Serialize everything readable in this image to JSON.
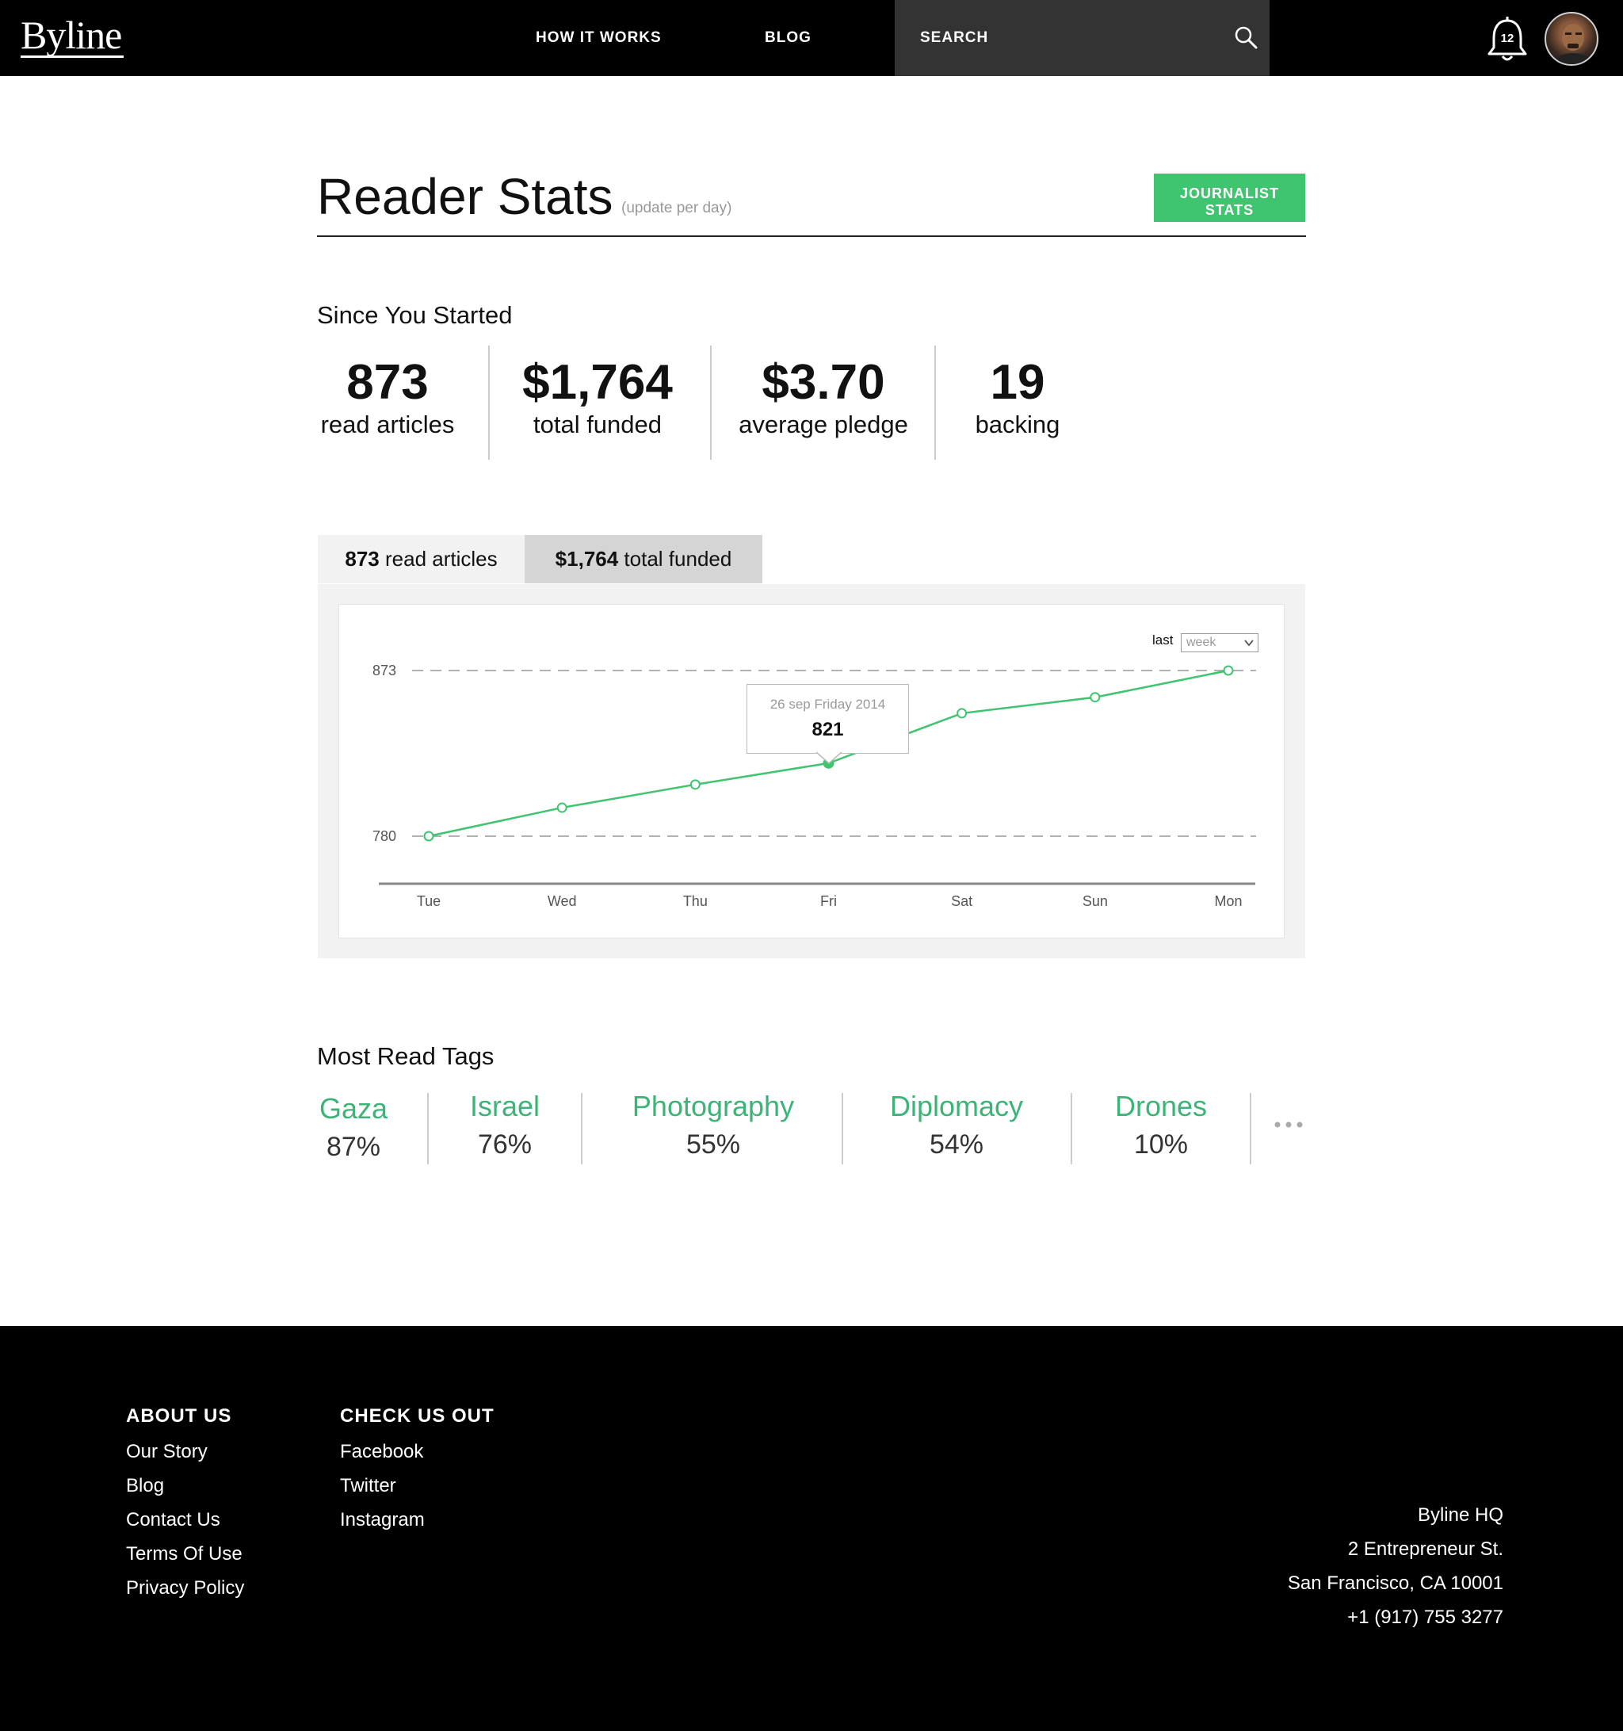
{
  "nav": {
    "logo": "Byline",
    "how_it_works": "HOW IT WORKS",
    "blog": "BLOG",
    "search_placeholder": "SEARCH",
    "notification_count": "12"
  },
  "header": {
    "title": "Reader Stats",
    "subtitle": "(update per day)",
    "journalist_button_line1": "JOURNALIST",
    "journalist_button_line2": "STATS"
  },
  "since": {
    "title": "Since You Started",
    "stats": [
      {
        "value": "873",
        "label": "read articles"
      },
      {
        "value": "$1,764",
        "label": "total funded"
      },
      {
        "value": "$3.70",
        "label": "average pledge"
      },
      {
        "value": "19",
        "label": "backing"
      }
    ]
  },
  "tabs": [
    {
      "value": "873",
      "label": " read articles"
    },
    {
      "value": "$1,764",
      "label": " total funded"
    }
  ],
  "period": {
    "label": "last",
    "selected": "week"
  },
  "tooltip": {
    "date": "26 sep Friday 2014",
    "value": "821"
  },
  "chart_data": {
    "type": "line",
    "categories": [
      "Tue",
      "Wed",
      "Thu",
      "Fri",
      "Sat",
      "Sun",
      "Mon"
    ],
    "series": [
      {
        "values": [
          780,
          796,
          809,
          821,
          849,
          858,
          873
        ]
      }
    ],
    "ylim": [
      780,
      873
    ],
    "y_ticks": [
      780,
      873
    ],
    "highlight_index": 3,
    "grid": "dashed",
    "colors": {
      "line": "#3fc46f",
      "grid": "#999999",
      "axis": "#888888"
    }
  },
  "tags": {
    "title": "Most Read Tags",
    "items": [
      {
        "name": "Gaza",
        "pct": "87%"
      },
      {
        "name": "Israel",
        "pct": "76%"
      },
      {
        "name": "Photography",
        "pct": "55%"
      },
      {
        "name": "Diplomacy",
        "pct": "54%"
      },
      {
        "name": "Drones",
        "pct": "10%"
      }
    ]
  },
  "footer": {
    "about_heading": "ABOUT US",
    "about_links": [
      "Our Story",
      "Blog",
      "Contact Us",
      "Terms Of Use",
      "Privacy Policy"
    ],
    "check_heading": "CHECK US OUT",
    "check_links": [
      "Facebook",
      "Twitter",
      "Instagram"
    ],
    "address": [
      "Byline HQ",
      "2 Entrepreneur St.",
      "San Francisco, CA 10001",
      "+1 (917) 755 3277"
    ]
  },
  "colors": {
    "accent": "#3fc46f",
    "tag_green": "#3db477",
    "nav_bg": "#000000",
    "search_bg": "#333333"
  }
}
